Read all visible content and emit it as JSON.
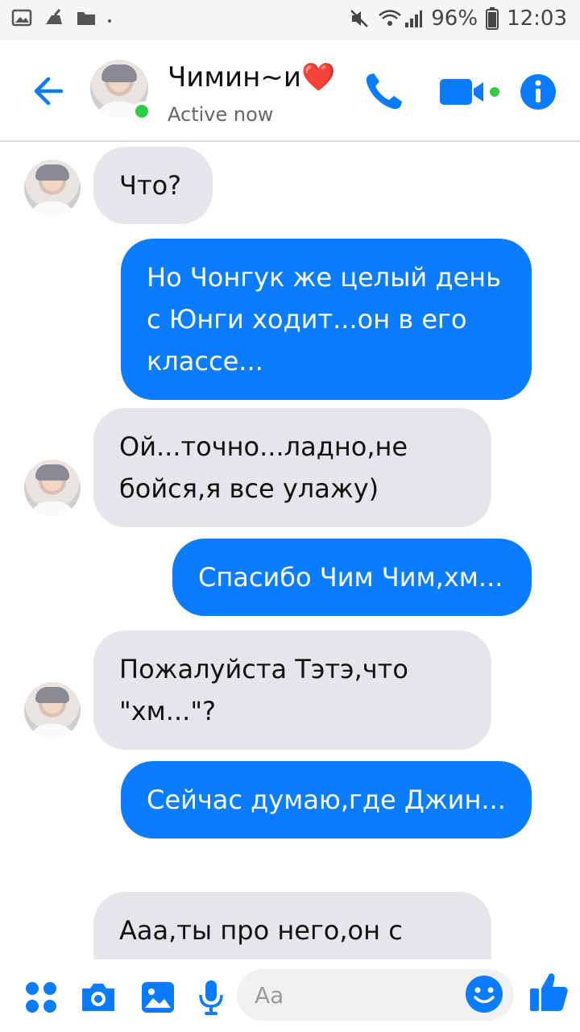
{
  "status_bar": {
    "battery": "96%",
    "time": "12:03"
  },
  "header": {
    "contact_name": "Чимин~и❤️",
    "contact_status": "Active now",
    "icons": [
      "back-arrow-icon",
      "phone-icon",
      "video-camera-icon",
      "info-icon"
    ]
  },
  "messages": [
    {
      "direction": "in",
      "text": "Что?"
    },
    {
      "direction": "out",
      "text": "Но Чонгук же целый день с Юнги ходит...он в его классе..."
    },
    {
      "direction": "in",
      "text": "Ой...точно...ладно,не бойся,я все улажу)"
    },
    {
      "direction": "out",
      "text": "Спасибо Чим Чим,хм..."
    },
    {
      "direction": "in",
      "text": "Пожалуйста Тэтэ,что \"хм...\"?"
    },
    {
      "direction": "out",
      "text": "Сейчас думаю,где Джин..."
    },
    {
      "direction": "in",
      "text": "Ааа,ты про него,он с"
    }
  ],
  "composer": {
    "placeholder": "Aa",
    "icons": [
      "apps-icon",
      "camera-icon",
      "gallery-icon",
      "microphone-icon",
      "emoji-icon",
      "thumbs-up-icon"
    ]
  },
  "colors": {
    "accent": "#0a7cff",
    "incoming_bubble": "#e6e6ea",
    "online": "#31cc46"
  }
}
